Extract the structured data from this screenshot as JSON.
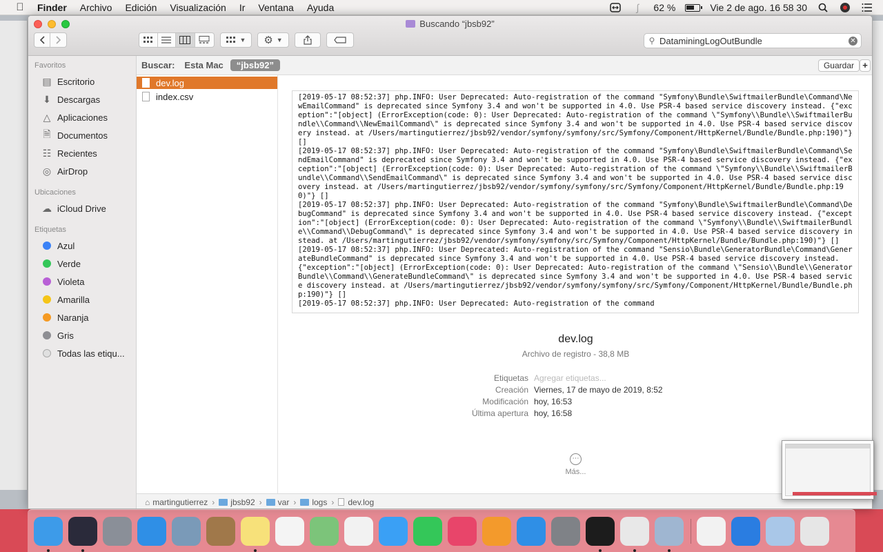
{
  "menubar": {
    "app": "Finder",
    "items": [
      "Archivo",
      "Edición",
      "Visualización",
      "Ir",
      "Ventana",
      "Ayuda"
    ],
    "battery": "62 %",
    "clock": "Vie 2 de ago.  16 58 30"
  },
  "window": {
    "title": "Buscando “jbsb92”",
    "search_value": "DataminingLogOutBundle"
  },
  "sidebar": {
    "favorites_header": "Favoritos",
    "favorites": [
      {
        "label": "Escritorio",
        "icon": "desktop-icon"
      },
      {
        "label": "Descargas",
        "icon": "downloads-icon"
      },
      {
        "label": "Aplicaciones",
        "icon": "applications-icon"
      },
      {
        "label": "Documentos",
        "icon": "documents-icon"
      },
      {
        "label": "Recientes",
        "icon": "recents-icon"
      },
      {
        "label": "AirDrop",
        "icon": "airdrop-icon"
      }
    ],
    "locations_header": "Ubicaciones",
    "locations": [
      {
        "label": "iCloud Drive",
        "icon": "cloud-icon"
      }
    ],
    "tags_header": "Etiquetas",
    "tags": [
      {
        "label": "Azul",
        "color": "#3b82f6"
      },
      {
        "label": "Verde",
        "color": "#34c759"
      },
      {
        "label": "Violeta",
        "color": "#b860d6"
      },
      {
        "label": "Amarilla",
        "color": "#f5c518"
      },
      {
        "label": "Naranja",
        "color": "#f59a23"
      },
      {
        "label": "Gris",
        "color": "#8e8e93"
      },
      {
        "label": "Todas las etiqu...",
        "color": "#e0e0e0"
      }
    ]
  },
  "scope": {
    "label": "Buscar:",
    "option": "Esta Mac",
    "active": "“jbsb92”",
    "save": "Guardar",
    "plus": "+"
  },
  "files": [
    "dev.log",
    "index.csv"
  ],
  "preview": {
    "log_text": "[2019-05-17 08:52:37] php.INFO: User Deprecated: Auto-registration of the command \"Symfony\\Bundle\\SwiftmailerBundle\\Command\\NewEmailCommand\" is deprecated since Symfony 3.4 and won't be supported in 4.0. Use PSR-4 based service discovery instead. {\"exception\":\"[object] (ErrorException(code: 0): User Deprecated: Auto-registration of the command \\\"Symfony\\\\Bundle\\\\SwiftmailerBundle\\\\Command\\\\NewEmailCommand\\\" is deprecated since Symfony 3.4 and won't be supported in 4.0. Use PSR-4 based service discovery instead. at /Users/martingutierrez/jbsb92/vendor/symfony/symfony/src/Symfony/Component/HttpKernel/Bundle/Bundle.php:190)\"} []\n[2019-05-17 08:52:37] php.INFO: User Deprecated: Auto-registration of the command \"Symfony\\Bundle\\SwiftmailerBundle\\Command\\SendEmailCommand\" is deprecated since Symfony 3.4 and won't be supported in 4.0. Use PSR-4 based service discovery instead. {\"exception\":\"[object] (ErrorException(code: 0): User Deprecated: Auto-registration of the command \\\"Symfony\\\\Bundle\\\\SwiftmailerBundle\\\\Command\\\\SendEmailCommand\\\" is deprecated since Symfony 3.4 and won't be supported in 4.0. Use PSR-4 based service discovery instead. at /Users/martingutierrez/jbsb92/vendor/symfony/symfony/src/Symfony/Component/HttpKernel/Bundle/Bundle.php:190)\"} []\n[2019-05-17 08:52:37] php.INFO: User Deprecated: Auto-registration of the command \"Symfony\\Bundle\\SwiftmailerBundle\\Command\\DebugCommand\" is deprecated since Symfony 3.4 and won't be supported in 4.0. Use PSR-4 based service discovery instead. {\"exception\":\"[object] (ErrorException(code: 0): User Deprecated: Auto-registration of the command \\\"Symfony\\\\Bundle\\\\SwiftmailerBundle\\\\Command\\\\DebugCommand\\\" is deprecated since Symfony 3.4 and won't be supported in 4.0. Use PSR-4 based service discovery instead. at /Users/martingutierrez/jbsb92/vendor/symfony/symfony/src/Symfony/Component/HttpKernel/Bundle/Bundle.php:190)\"} []\n[2019-05-17 08:52:37] php.INFO: User Deprecated: Auto-registration of the command \"Sensio\\Bundle\\GeneratorBundle\\Command\\GenerateBundleCommand\" is deprecated since Symfony 3.4 and won't be supported in 4.0. Use PSR-4 based service discovery instead. {\"exception\":\"[object] (ErrorException(code: 0): User Deprecated: Auto-registration of the command \\\"Sensio\\\\Bundle\\\\GeneratorBundle\\\\Command\\\\GenerateBundleCommand\\\" is deprecated since Symfony 3.4 and won't be supported in 4.0. Use PSR-4 based service discovery instead. at /Users/martingutierrez/jbsb92/vendor/symfony/symfony/src/Symfony/Component/HttpKernel/Bundle/Bundle.php:190)\"} []\n[2019-05-17 08:52:37] php.INFO: User Deprecated: Auto-registration of the command",
    "name": "dev.log",
    "kind": "Archivo de registro - 38,8 MB",
    "meta": [
      {
        "key": "Etiquetas",
        "value": "Agregar etiquetas...",
        "placeholder": true
      },
      {
        "key": "Creación",
        "value": "Viernes, 17 de mayo de 2019, 8:52"
      },
      {
        "key": "Modificación",
        "value": "hoy, 16:53"
      },
      {
        "key": "Última apertura",
        "value": "hoy, 16:58"
      }
    ],
    "more": "Más..."
  },
  "pathbar": [
    "martingutierrez",
    "jbsb92",
    "var",
    "logs",
    "dev.log"
  ],
  "dock": [
    {
      "name": "finder",
      "color": "#3d9be9",
      "running": true
    },
    {
      "name": "siri",
      "color": "#2a2a3a",
      "running": true
    },
    {
      "name": "launchpad",
      "color": "#8a8f98",
      "running": false
    },
    {
      "name": "safari",
      "color": "#2f8fe6",
      "running": false
    },
    {
      "name": "preview",
      "color": "#7a9ab8",
      "running": false
    },
    {
      "name": "contacts",
      "color": "#a0784a",
      "running": false
    },
    {
      "name": "notes",
      "color": "#f7e17a",
      "running": true
    },
    {
      "name": "reminders",
      "color": "#f4f4f4",
      "running": false
    },
    {
      "name": "maps",
      "color": "#7cc47a",
      "running": false
    },
    {
      "name": "photos",
      "color": "#f2f2f2",
      "running": false
    },
    {
      "name": "messages",
      "color": "#3aa0f5",
      "running": false
    },
    {
      "name": "facetime",
      "color": "#34c759",
      "running": false
    },
    {
      "name": "itunes",
      "color": "#e8456a",
      "running": false
    },
    {
      "name": "books",
      "color": "#f39a2c",
      "running": false
    },
    {
      "name": "app-store",
      "color": "#2f8fe6",
      "running": false
    },
    {
      "name": "system-preferences",
      "color": "#7f8287",
      "running": false
    },
    {
      "name": "terminal",
      "color": "#1c1c1c",
      "running": true
    },
    {
      "name": "chrome",
      "color": "#e8e8e8",
      "running": true
    },
    {
      "name": "utility-app",
      "color": "#9fb6d1",
      "running": true
    }
  ],
  "dock_right": [
    {
      "name": "textedit",
      "color": "#f2f2f2",
      "running": false
    },
    {
      "name": "teamviewer",
      "color": "#2a7de1",
      "running": false
    },
    {
      "name": "cube-app",
      "color": "#a9c7e8",
      "running": false
    },
    {
      "name": "trash",
      "color": "#e6e6e6",
      "running": false
    }
  ]
}
